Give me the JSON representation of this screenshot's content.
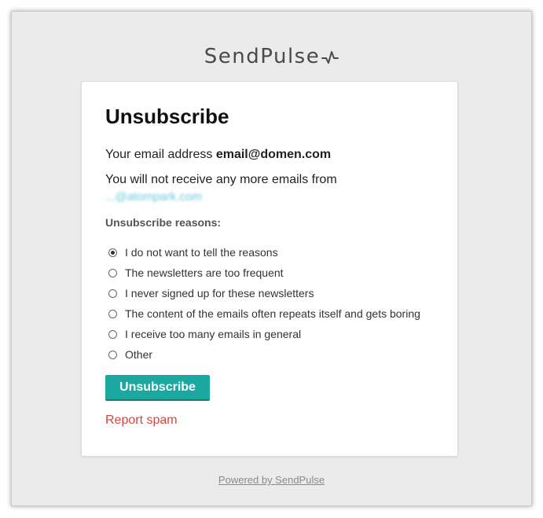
{
  "logo": {
    "text": "SendPulse"
  },
  "card": {
    "title": "Unsubscribe",
    "email_prefix": "Your email address",
    "email": "email@domen.com",
    "from_text": "You will not receive any more emails from",
    "sender_obscured": "...@atompark.com",
    "reasons_label": "Unsubscribe reasons:",
    "reasons": [
      {
        "label": "I do not want to tell the reasons",
        "checked": true
      },
      {
        "label": "The newsletters are too frequent",
        "checked": false
      },
      {
        "label": "I never signed up for these newsletters",
        "checked": false
      },
      {
        "label": "The content of the emails often repeats itself and gets boring",
        "checked": false
      },
      {
        "label": "I receive too many emails in general",
        "checked": false
      },
      {
        "label": "Other",
        "checked": false
      }
    ],
    "submit_label": "Unsubscribe",
    "report_spam": "Report spam"
  },
  "footer": {
    "powered_by": "Powered by SendPulse"
  },
  "colors": {
    "accent": "#1aa8a0",
    "spam": "#d9443f",
    "background": "#ebebeb"
  }
}
